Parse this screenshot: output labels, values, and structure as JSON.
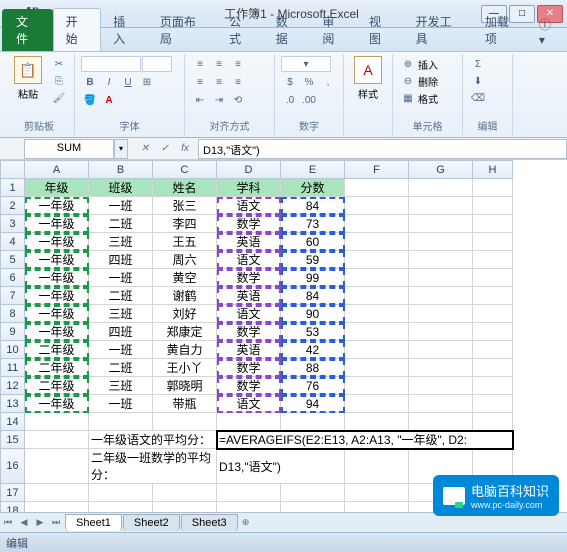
{
  "title": "工作簿1 - Microsoft Excel",
  "ribbon": {
    "file": "文件",
    "tabs": [
      "开始",
      "插入",
      "页面布局",
      "公式",
      "数据",
      "审阅",
      "视图",
      "开发工具",
      "加载项"
    ],
    "active": 0,
    "groups": {
      "clipboard": {
        "label": "剪贴板",
        "paste": "粘贴"
      },
      "font": {
        "label": "字体"
      },
      "alignment": {
        "label": "对齐方式"
      },
      "number": {
        "label": "数字"
      },
      "styles": {
        "label": "样式"
      },
      "cells": {
        "label": "单元格",
        "insert": "插入",
        "delete": "删除",
        "format": "格式"
      },
      "editing": {
        "label": "编辑"
      }
    }
  },
  "nameBox": "SUM",
  "formulaBar": "D13,\"语文\")",
  "columns": [
    "A",
    "B",
    "C",
    "D",
    "E",
    "F",
    "G",
    "H"
  ],
  "headers": {
    "A": "年级",
    "B": "班级",
    "C": "姓名",
    "D": "学科",
    "E": "分数"
  },
  "rows": [
    {
      "n": 2,
      "A": "一年级",
      "B": "一班",
      "C": "张三",
      "D": "语文",
      "E": "84"
    },
    {
      "n": 3,
      "A": "一年级",
      "B": "二班",
      "C": "李四",
      "D": "数学",
      "E": "73"
    },
    {
      "n": 4,
      "A": "一年级",
      "B": "三班",
      "C": "王五",
      "D": "英语",
      "E": "60"
    },
    {
      "n": 5,
      "A": "一年级",
      "B": "四班",
      "C": "周六",
      "D": "语文",
      "E": "59"
    },
    {
      "n": 6,
      "A": "一年级",
      "B": "一班",
      "C": "黄空",
      "D": "数学",
      "E": "99"
    },
    {
      "n": 7,
      "A": "一年级",
      "B": "二班",
      "C": "谢鹤",
      "D": "英语",
      "E": "84"
    },
    {
      "n": 8,
      "A": "一年级",
      "B": "三班",
      "C": "刘好",
      "D": "语文",
      "E": "90"
    },
    {
      "n": 9,
      "A": "一年级",
      "B": "四班",
      "C": "郑康定",
      "D": "数学",
      "E": "53"
    },
    {
      "n": 10,
      "A": "二年级",
      "B": "一班",
      "C": "黄自力",
      "D": "英语",
      "E": "42"
    },
    {
      "n": 11,
      "A": "二年级",
      "B": "二班",
      "C": "王小丫",
      "D": "数学",
      "E": "88"
    },
    {
      "n": 12,
      "A": "二年级",
      "B": "三班",
      "C": "郭晓明",
      "D": "数学",
      "E": "76"
    },
    {
      "n": 13,
      "A": "一年级",
      "B": "一班",
      "C": "带瓶",
      "D": "语文",
      "E": "94"
    }
  ],
  "labelsRow15": {
    "label": "一年级语文的平均分：",
    "formulaL1": "=AVERAGEIFS(E2:E13, A2:A13, \"一年级\", D2:"
  },
  "labelsRow16": {
    "label": "二年级一班数学的平均分：",
    "formulaL2": "D13,\"语文\")"
  },
  "sheetTabs": [
    "Sheet1",
    "Sheet2",
    "Sheet3"
  ],
  "status": "编辑",
  "watermark": {
    "title": "电脑百科知识",
    "sub": "www.pc-daily.com"
  }
}
